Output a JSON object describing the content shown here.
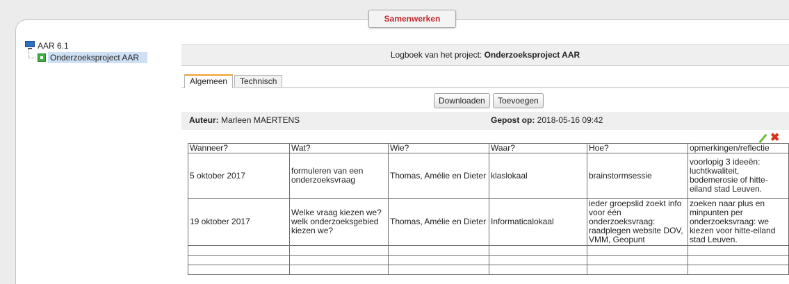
{
  "app_tab": "Samenwerken",
  "tree": {
    "root": "AAR 6.1",
    "child": "Onderzoeksproject AAR"
  },
  "logbook": {
    "prefix": "Logboek van het project:",
    "project": "Onderzoeksproject AAR"
  },
  "tabs": [
    "Algemeen",
    "Technisch"
  ],
  "buttons": {
    "download": "Downloaden",
    "add": "Toevoegen"
  },
  "entry": {
    "author_label": "Auteur:",
    "author": "Marleen MAERTENS",
    "posted_label": "Gepost op:",
    "posted": "2018-05-16 09:42"
  },
  "icons": {
    "edit": "pencil-icon",
    "delete": "close-icon"
  },
  "colors": {
    "accent_red": "#c0272d",
    "tab_active": "#f0a030",
    "tree_selected": "#cfe0f5"
  },
  "table": {
    "headers": [
      "Wanneer?",
      "Wat?",
      "Wie?",
      "Waar?",
      "Hoe?",
      "opmerkingen/reflectie"
    ],
    "rows": [
      [
        "5 oktober 2017",
        "formuleren van een onderzoeksvraag",
        "Thomas, Amélie en Dieter",
        "klaslokaal",
        "brainstormsessie",
        "voorlopig 3 ideeën: luchtkwaliteit, bodemerosie of hitte-eiland stad Leuven."
      ],
      [
        "19 oktober 2017",
        "Welke vraag kiezen we? welk onderzoeksgebied kiezen we?",
        "Thomas, Amélie en Dieter",
        "Informaticalokaal",
        "ieder groepslid zoekt info voor één onderzoeksvraag: raadplegen website DOV, VMM, Geopunt",
        "zoeken naar plus en minpunten per onderzoeksvraag: we kiezen voor hitte-eiland stad Leuven."
      ]
    ]
  }
}
